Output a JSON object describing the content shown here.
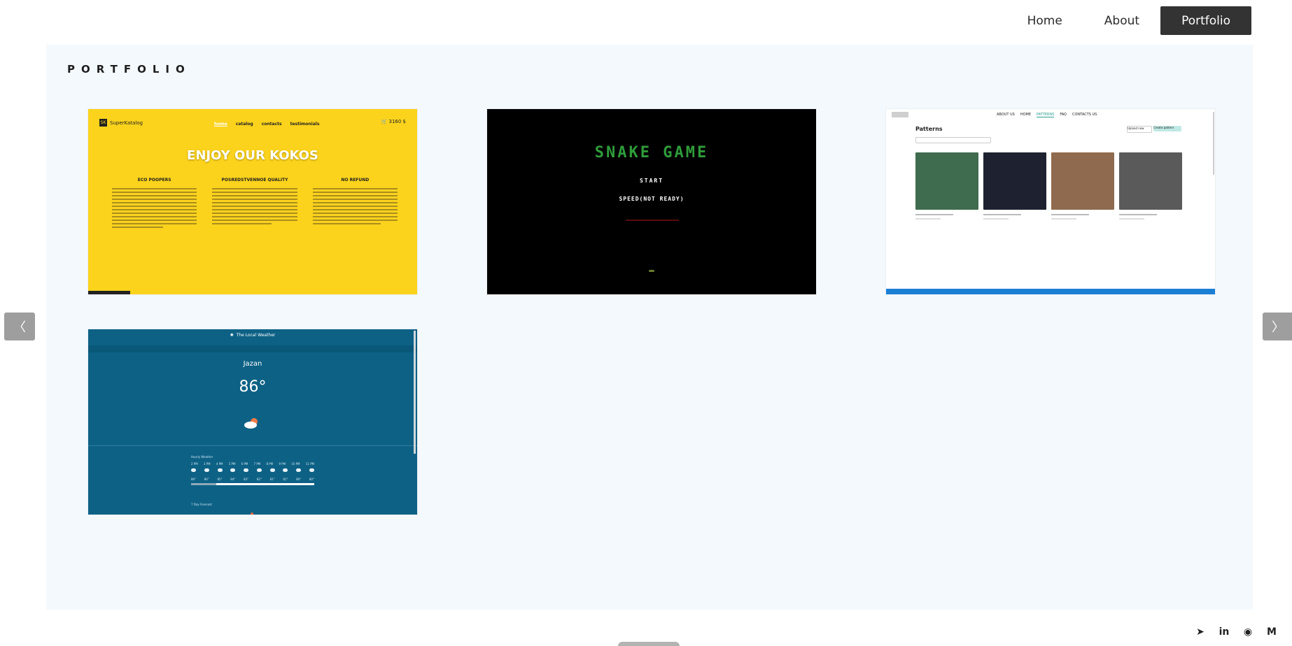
{
  "nav": {
    "items": [
      {
        "label": "Home",
        "active": false
      },
      {
        "label": "About",
        "active": false
      },
      {
        "label": "Portfolio",
        "active": true
      }
    ]
  },
  "portfolio": {
    "title": "PORTFOLIO",
    "cards": [
      {
        "name": "kokos",
        "logo": "SuperKatalog",
        "nav": [
          "home",
          "catalog",
          "contacts",
          "testimonials"
        ],
        "cart": "3160 $",
        "hero": "ENJOY OUR KOKOS",
        "columns": [
          "ECO POOPERS",
          "POSREDSTVENNOE QUALITY",
          "NO REFUND"
        ]
      },
      {
        "name": "snake-game",
        "title": "SNAKE GAME",
        "start": "START",
        "speed": "SPEED(NOT READY)"
      },
      {
        "name": "patterns",
        "nav": [
          "ABOUT US",
          "HOME",
          "PATTERNS",
          "FAQ",
          "CONTACTS US"
        ],
        "heading": "Patterns",
        "buttons": [
          "Upload new",
          "Create pattern"
        ]
      },
      {
        "name": "weather",
        "app_title": "The Local Weather",
        "city": "Jazan",
        "temp": "86°",
        "hourly_label": "Hourly Weather",
        "hours": [
          "2 PM",
          "3 PM",
          "4 PM",
          "5 PM",
          "6 PM",
          "7 PM",
          "8 PM",
          "9 PM",
          "10 PM",
          "11 PM"
        ],
        "temps": [
          "86°",
          "86°",
          "85°",
          "84°",
          "83°",
          "82°",
          "81°",
          "81°",
          "80°",
          "80°"
        ],
        "weekly_label": "7 Day Forecast"
      }
    ]
  },
  "arrows": {
    "left": "〈",
    "right": "〉"
  },
  "social": [
    {
      "icon": "telegram-icon",
      "glyph": "➤"
    },
    {
      "icon": "linkedin-icon",
      "glyph": "in"
    },
    {
      "icon": "github-icon",
      "glyph": "◉"
    },
    {
      "icon": "gmail-icon",
      "glyph": "M"
    }
  ]
}
